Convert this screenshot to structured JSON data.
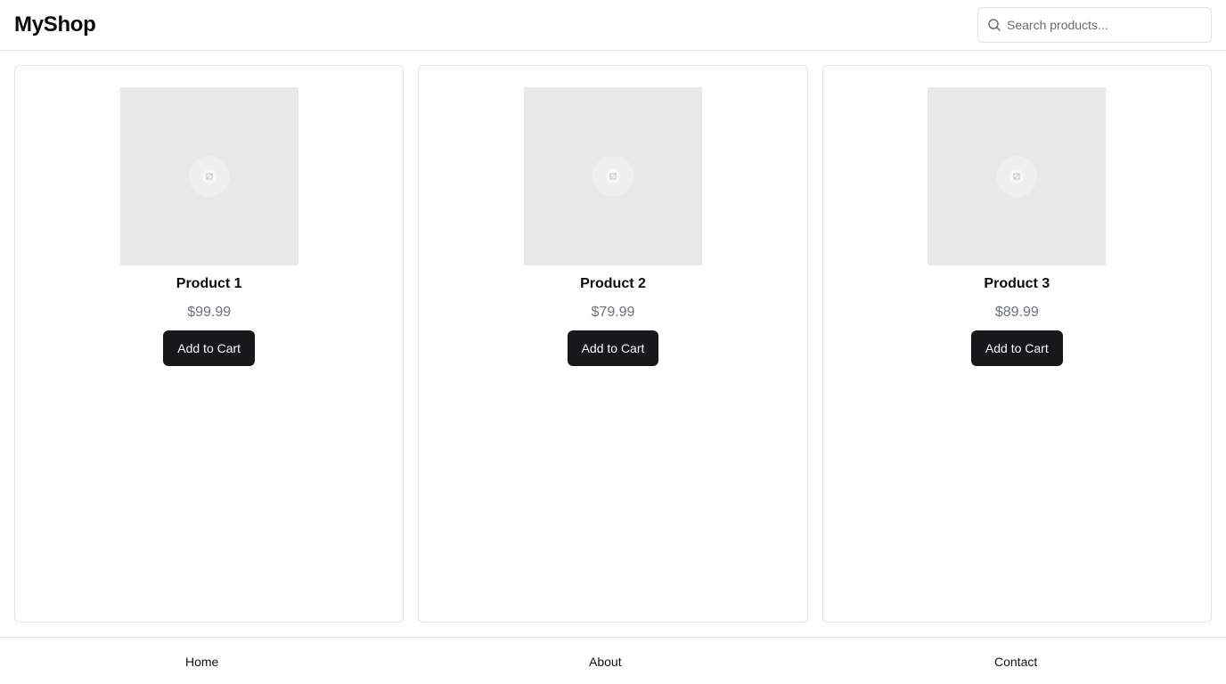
{
  "header": {
    "logo": "MyShop",
    "search": {
      "placeholder": "Search products...",
      "value": "",
      "icon": "search-icon"
    }
  },
  "products": [
    {
      "name": "Product 1",
      "price": "$99.99",
      "button": "Add to Cart",
      "image_icon": "image-placeholder-icon"
    },
    {
      "name": "Product 2",
      "price": "$79.99",
      "button": "Add to Cart",
      "image_icon": "image-placeholder-icon"
    },
    {
      "name": "Product 3",
      "price": "$89.99",
      "button": "Add to Cart",
      "image_icon": "image-placeholder-icon"
    }
  ],
  "footer": {
    "links": [
      "Home",
      "About",
      "Contact"
    ]
  },
  "colors": {
    "button_bg": "#18181b",
    "button_text": "#fafafa",
    "price_text": "#6b7280",
    "image_placeholder": "#e9e9e9",
    "border": "#e4e4e4"
  }
}
